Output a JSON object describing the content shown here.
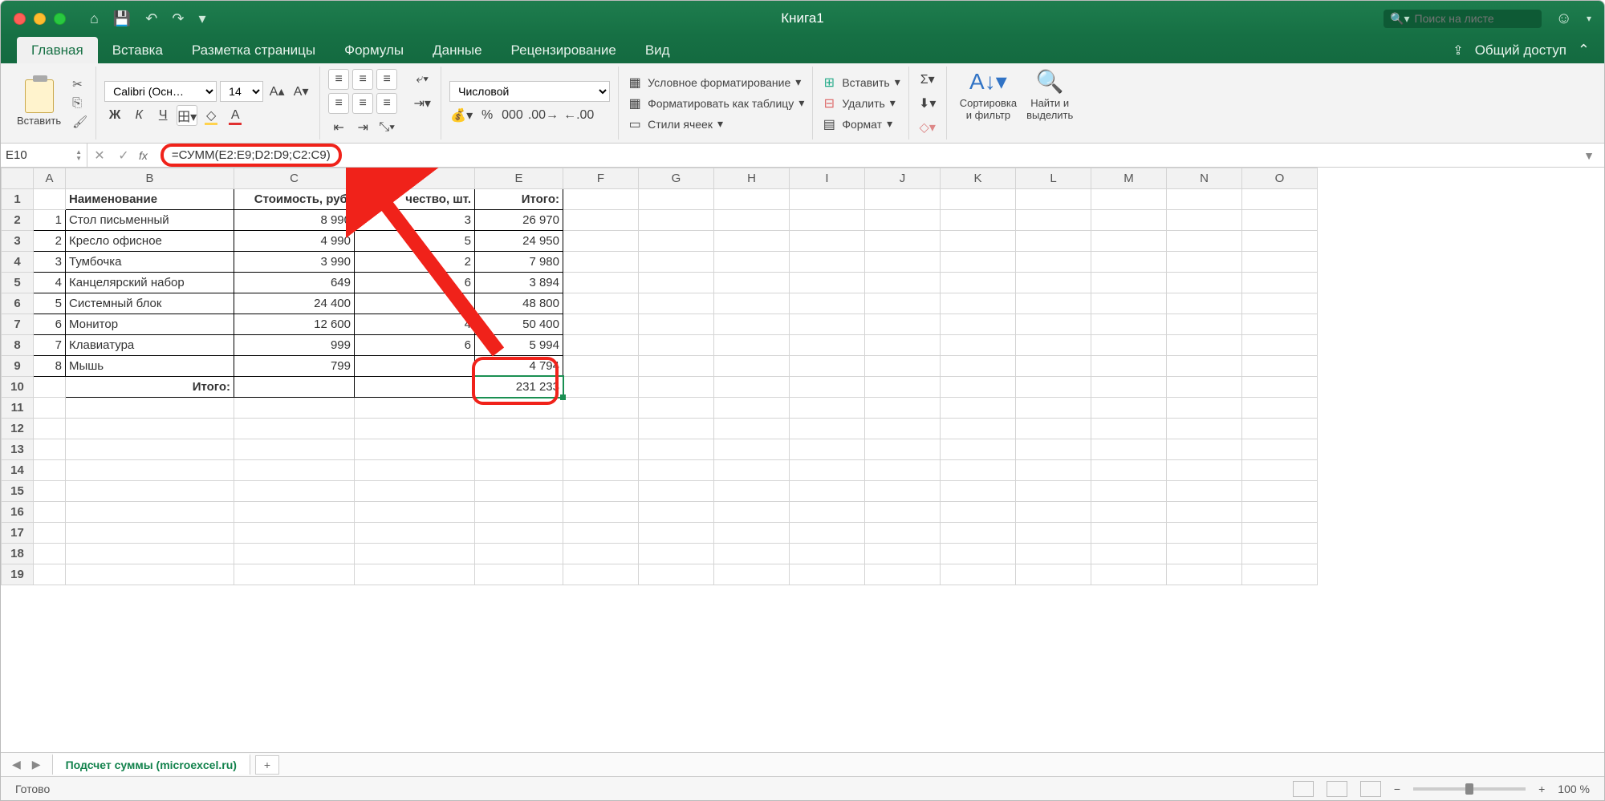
{
  "titlebar": {
    "window_title": "Книга1",
    "search_placeholder": "Поиск на листе"
  },
  "tabs": {
    "items": [
      "Главная",
      "Вставка",
      "Разметка страницы",
      "Формулы",
      "Данные",
      "Рецензирование",
      "Вид"
    ],
    "active": 0,
    "share_label": "Общий доступ"
  },
  "ribbon": {
    "paste_label": "Вставить",
    "font_name": "Calibri (Осн…",
    "font_size": "14",
    "bold": "Ж",
    "italic": "К",
    "underline": "Ч",
    "number_format": "Числовой",
    "cond_format": "Условное форматирование",
    "format_table": "Форматировать как таблицу",
    "cell_styles": "Стили ячеек",
    "insert": "Вставить",
    "delete": "Удалить",
    "format": "Формат",
    "sort_filter": "Сортировка\nи фильтр",
    "find_select": "Найти и\nвыделить"
  },
  "fbar": {
    "name": "E10",
    "formula": "=СУММ(E2:E9;D2:D9;C2:C9)"
  },
  "columns": [
    "A",
    "B",
    "C",
    "D",
    "E",
    "F",
    "G",
    "H",
    "I",
    "J",
    "K",
    "L",
    "M",
    "N",
    "O"
  ],
  "header_row": {
    "b": "Наименование",
    "c": "Стоимость, руб.",
    "d": "чество, шт.",
    "e": "Итого:"
  },
  "data_rows": [
    {
      "n": "1",
      "name": "Стол письменный",
      "cost": "8 990",
      "qty": "3",
      "total": "26 970"
    },
    {
      "n": "2",
      "name": "Кресло офисное",
      "cost": "4 990",
      "qty": "5",
      "total": "24 950"
    },
    {
      "n": "3",
      "name": "Тумбочка",
      "cost": "3 990",
      "qty": "2",
      "total": "7 980"
    },
    {
      "n": "4",
      "name": "Канцелярский набор",
      "cost": "649",
      "qty": "6",
      "total": "3 894"
    },
    {
      "n": "5",
      "name": "Системный блок",
      "cost": "24 400",
      "qty": "",
      "total": "48 800"
    },
    {
      "n": "6",
      "name": "Монитор",
      "cost": "12 600",
      "qty": "4",
      "total": "50 400"
    },
    {
      "n": "7",
      "name": "Клавиатура",
      "cost": "999",
      "qty": "6",
      "total": "5 994"
    },
    {
      "n": "8",
      "name": "Мышь",
      "cost": "799",
      "qty": "",
      "total": "4 794"
    }
  ],
  "total_row": {
    "label": "Итого:",
    "value": "231 233"
  },
  "sheet_tab_name": "Подсчет суммы (microexcel.ru)",
  "status": {
    "ready": "Готово",
    "zoom": "100 %"
  }
}
